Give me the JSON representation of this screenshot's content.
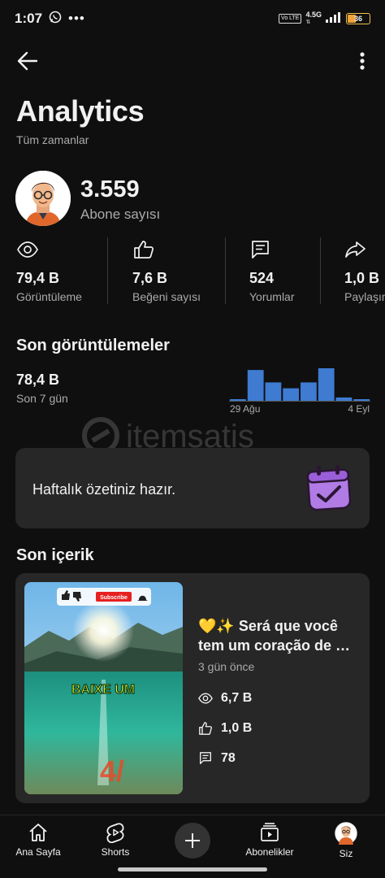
{
  "status_bar": {
    "time": "1:07",
    "network": "4.5G",
    "lte": "Vo LTE",
    "battery": "36"
  },
  "header": {
    "title": "Analytics",
    "subtitle": "Tüm zamanlar"
  },
  "subscribers": {
    "count": "3.559",
    "label": "Abone sayısı"
  },
  "metrics": [
    {
      "icon": "eye-icon",
      "value": "79,4 B",
      "label": "Görüntüleme"
    },
    {
      "icon": "thumbs-up-icon",
      "value": "7,6 B",
      "label": "Beğeni sayısı"
    },
    {
      "icon": "comment-icon",
      "value": "524",
      "label": "Yorumlar"
    },
    {
      "icon": "share-icon",
      "value": "1,0 B",
      "label": "Paylaşım"
    }
  ],
  "recent_views": {
    "title": "Son görüntülemeler",
    "value": "78,4 B",
    "period": "Son 7 gün",
    "chart_data": {
      "type": "bar",
      "categories": [
        "29 Ağu",
        "",
        "",
        "",
        "",
        "",
        "",
        "4 Eyl"
      ],
      "values": [
        1,
        37,
        22,
        15,
        22,
        39,
        4,
        0
      ],
      "x_start_label": "29 Ağu",
      "x_end_label": "4 Eyl",
      "bar_color": "#3e7bd1"
    }
  },
  "weekly_summary": {
    "text": "Haftalık özetiniz hazır."
  },
  "recent_content": {
    "title": "Son içerik",
    "video_title": "💛✨ Será que você tem um coração de …",
    "date": "3 gün önce",
    "views": "6,7 B",
    "likes": "1,0 B",
    "comments": "78",
    "thumbnail_text": "BAIXE UM",
    "thumbnail_subscribe": "Subscribe",
    "thumbnail_number": "4/"
  },
  "bottom_nav": {
    "home": "Ana Sayfa",
    "shorts": "Shorts",
    "subscriptions": "Abonelikler",
    "you": "Siz"
  },
  "colors": {
    "background": "#0f0f0f",
    "card": "#272727",
    "accent": "#3e7bd1",
    "muted": "#aaaaaa"
  }
}
